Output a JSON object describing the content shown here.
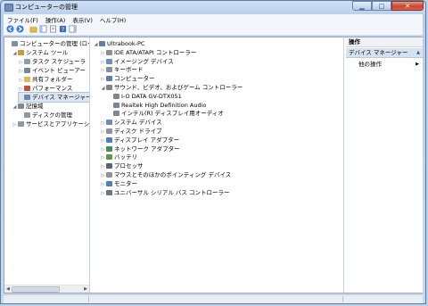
{
  "window": {
    "title": "コンピューターの管理"
  },
  "menu": [
    "ファイル(F)",
    "操作(A)",
    "表示(V)",
    "ヘルプ(H)"
  ],
  "left_tree": [
    {
      "label": "コンピューターの管理 (ローカ",
      "level": 0,
      "twisty": "",
      "icon": "computer-management-icon",
      "color": "#7b8fa8"
    },
    {
      "label": "システム ツール",
      "level": 1,
      "twisty": "◢",
      "icon": "system-tools-icon",
      "color": "#c59b3f"
    },
    {
      "label": "タスク スケジューラ",
      "level": 2,
      "twisty": "▷",
      "icon": "task-scheduler-icon",
      "color": "#8a9cb3"
    },
    {
      "label": "イベント ビューアー",
      "level": 2,
      "twisty": "▷",
      "icon": "event-viewer-icon",
      "color": "#7a8694"
    },
    {
      "label": "共有フォルダー",
      "level": 2,
      "twisty": "▷",
      "icon": "shared-folder-icon",
      "color": "#e2b84c"
    },
    {
      "label": "パフォーマンス",
      "level": 2,
      "twisty": "▷",
      "icon": "performance-icon",
      "color": "#c04f3b"
    },
    {
      "label": "デバイス マネージャー",
      "level": 2,
      "twisty": "",
      "icon": "device-manager-icon",
      "color": "#6f88a8",
      "selected": true
    },
    {
      "label": "記憶域",
      "level": 1,
      "twisty": "◢",
      "icon": "storage-icon",
      "color": "#7e8a98"
    },
    {
      "label": "ディスクの管理",
      "level": 2,
      "twisty": "",
      "icon": "disk-management-icon",
      "color": "#8a97a6"
    },
    {
      "label": "サービスとアプリケーション",
      "level": 1,
      "twisty": "▷",
      "icon": "services-icon",
      "color": "#8c98a6"
    }
  ],
  "device_tree": [
    {
      "label": "Ultrabook-PC",
      "level": 0,
      "twisty": "◢",
      "icon": "computer-icon",
      "color": "#5d7fa6"
    },
    {
      "label": "IDE ATA/ATAPI コントローラー",
      "level": 1,
      "twisty": "▷",
      "icon": "ide-controller-icon",
      "color": "#8a8f95"
    },
    {
      "label": "イメージング デバイス",
      "level": 1,
      "twisty": "▷",
      "icon": "imaging-device-icon",
      "color": "#6f8fb8"
    },
    {
      "label": "キーボード",
      "level": 1,
      "twisty": "▷",
      "icon": "keyboard-icon",
      "color": "#8a9099"
    },
    {
      "label": "コンピューター",
      "level": 1,
      "twisty": "▷",
      "icon": "computer-icon",
      "color": "#5d7fa6"
    },
    {
      "label": "サウンド、ビデオ、およびゲーム コントローラー",
      "level": 1,
      "twisty": "◢",
      "icon": "sound-icon",
      "color": "#7d8794"
    },
    {
      "label": "I-O DATA GV-DTX051",
      "level": 2,
      "twisty": "",
      "icon": "speaker-icon",
      "color": "#7d8794"
    },
    {
      "label": "Realtek High Definition Audio",
      "level": 2,
      "twisty": "",
      "icon": "speaker-icon",
      "color": "#7d8794"
    },
    {
      "label": "インテル(R) ディスプレイ用オーディオ",
      "level": 2,
      "twisty": "",
      "icon": "speaker-icon",
      "color": "#7d8794"
    },
    {
      "label": "システム デバイス",
      "level": 1,
      "twisty": "▷",
      "icon": "system-device-icon",
      "color": "#6b8eb8"
    },
    {
      "label": "ディスク ドライブ",
      "level": 1,
      "twisty": "▷",
      "icon": "disk-drive-icon",
      "color": "#8c939b"
    },
    {
      "label": "ディスプレイ アダプター",
      "level": 1,
      "twisty": "▷",
      "icon": "display-adapter-icon",
      "color": "#4f7fb5"
    },
    {
      "label": "ネットワーク アダプター",
      "level": 1,
      "twisty": "▷",
      "icon": "network-adapter-icon",
      "color": "#4b8a5f"
    },
    {
      "label": "バッテリ",
      "level": 1,
      "twisty": "▷",
      "icon": "battery-icon",
      "color": "#5a9a4a"
    },
    {
      "label": "プロセッサ",
      "level": 1,
      "twisty": "▷",
      "icon": "processor-icon",
      "color": "#5b6470"
    },
    {
      "label": "マウスとそのほかのポインティング デバイス",
      "level": 1,
      "twisty": "▷",
      "icon": "mouse-icon",
      "color": "#8d939a"
    },
    {
      "label": "モニター",
      "level": 1,
      "twisty": "▷",
      "icon": "monitor-icon",
      "color": "#4f7fb5"
    },
    {
      "label": "ユニバーサル シリアル バス コントローラー",
      "level": 1,
      "twisty": "▷",
      "icon": "usb-icon",
      "color": "#6d7580"
    }
  ],
  "actions": {
    "header": "操作",
    "section": "デバイス マネージャー",
    "item": "他の操作"
  }
}
